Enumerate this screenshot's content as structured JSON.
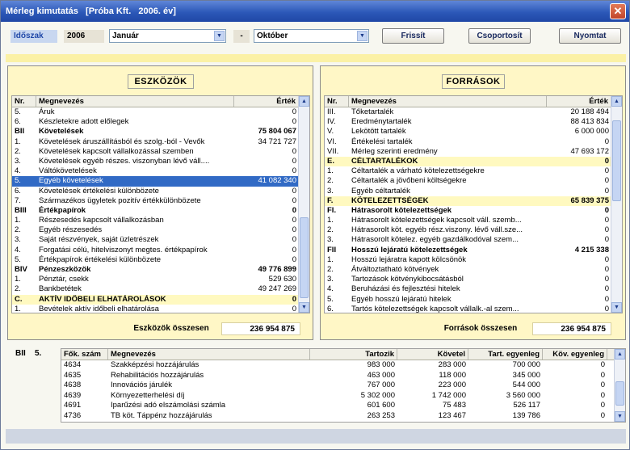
{
  "window": {
    "title": "Mérleg kimutatás   [Próba Kft.   2006. év]"
  },
  "toolbar": {
    "period_label": "Időszak",
    "year": "2006",
    "from_month": "Január",
    "dash": "-",
    "to_month": "Október",
    "refresh_label": "Frissít",
    "group_label": "Csoportosít",
    "print_label": "Nyomtat"
  },
  "assets": {
    "title": "ESZKÖZÖK",
    "col_nr": "Nr.",
    "col_name": "Megnevezés",
    "col_value": "Érték",
    "rows": [
      {
        "nr": "5.",
        "name": "Áruk",
        "value": "0"
      },
      {
        "nr": "6.",
        "name": "Készletekre adott előlegek",
        "value": "0"
      },
      {
        "nr": "BII",
        "name": "Követelések",
        "value": "75 804 067",
        "bold": true
      },
      {
        "nr": "1.",
        "name": "Követelések áruszállításból és szolg.-ból - Vevők",
        "value": "34 721 727"
      },
      {
        "nr": "2.",
        "name": "Követelések kapcsolt vállalkozással szemben",
        "value": "0"
      },
      {
        "nr": "3.",
        "name": "Követelések egyéb részes. viszonyban lévő váll....",
        "value": "0"
      },
      {
        "nr": "4.",
        "name": "Váltókövetelések",
        "value": "0"
      },
      {
        "nr": "5.",
        "name": "Egyéb követelések",
        "value": "41 082 340",
        "sel": true
      },
      {
        "nr": "6.",
        "name": "Követelések értékelési különbözete",
        "value": "0"
      },
      {
        "nr": "7.",
        "name": "Származékos ügyletek pozitív értékkülönbözete",
        "value": "0"
      },
      {
        "nr": "BIII",
        "name": "Értékpapírok",
        "value": "0",
        "bold": true
      },
      {
        "nr": "1.",
        "name": "Részesedés kapcsolt vállalkozásban",
        "value": "0"
      },
      {
        "nr": "2.",
        "name": "Egyéb részesedés",
        "value": "0"
      },
      {
        "nr": "3.",
        "name": "Saját részvények, saját üzletrészek",
        "value": "0"
      },
      {
        "nr": "4.",
        "name": "Forgatási célú, hitelviszonyt megtes. értékpapírok",
        "value": "0"
      },
      {
        "nr": "5.",
        "name": "Értékpapírok értékelési különbözete",
        "value": "0"
      },
      {
        "nr": "BIV",
        "name": "Pénzeszközök",
        "value": "49 776 899",
        "bold": true
      },
      {
        "nr": "1.",
        "name": "Pénztár, csekk",
        "value": "529 630"
      },
      {
        "nr": "2.",
        "name": "Bankbetétek",
        "value": "49 247 269"
      },
      {
        "nr": "C.",
        "name": "AKTÍV IDŐBELI ELHATÁROLÁSOK",
        "value": "0",
        "bold": true,
        "hl": true
      },
      {
        "nr": "1.",
        "name": "Bevételek aktív időbeli elhatárolása",
        "value": "0"
      }
    ],
    "total_label": "Eszközök összesen",
    "total_value": "236 954 875"
  },
  "liabilities": {
    "title": "FORRÁSOK",
    "col_nr": "Nr.",
    "col_name": "Megnevezés",
    "col_value": "Érték",
    "rows": [
      {
        "nr": "III.",
        "name": "Tőketartalék",
        "value": "20 188 494"
      },
      {
        "nr": "IV.",
        "name": "Eredménytartalék",
        "value": "88 413 834"
      },
      {
        "nr": "V.",
        "name": "Lekötött tartalék",
        "value": "6 000 000"
      },
      {
        "nr": "VI.",
        "name": "Értékelési tartalék",
        "value": "0"
      },
      {
        "nr": "VII.",
        "name": "Mérleg szerinti eredmény",
        "value": "47 693 172"
      },
      {
        "nr": "E.",
        "name": "CÉLTARTALÉKOK",
        "value": "0",
        "bold": true,
        "hl": true
      },
      {
        "nr": "1.",
        "name": "Céltartalék a várható kötelezettségekre",
        "value": "0"
      },
      {
        "nr": "2.",
        "name": "Céltartalék a jövőbeni költségekre",
        "value": "0"
      },
      {
        "nr": "3.",
        "name": "Egyéb céltartalék",
        "value": "0"
      },
      {
        "nr": "F.",
        "name": "KÖTELEZETTSÉGEK",
        "value": "65 839 375",
        "bold": true,
        "hl": true
      },
      {
        "nr": "FI.",
        "name": "Hátrasorolt kötelezettségek",
        "value": "0",
        "bold": true
      },
      {
        "nr": "1.",
        "name": "Hátrasorolt kötelezettségek kapcsolt váll. szemb...",
        "value": "0"
      },
      {
        "nr": "2.",
        "name": "Hátrasorolt köt. egyéb rész.viszony. lévő váll.sze...",
        "value": "0"
      },
      {
        "nr": "3.",
        "name": "Hátrasorolt kötelez. egyéb gazdálkodóval szem...",
        "value": "0"
      },
      {
        "nr": "FII",
        "name": "Hosszú lejáratú kötelezettségek",
        "value": "4 215 338",
        "bold": true
      },
      {
        "nr": "1.",
        "name": "Hosszú lejáratra kapott kölcsönök",
        "value": "0"
      },
      {
        "nr": "2.",
        "name": "Átváltoztatható kötvények",
        "value": "0"
      },
      {
        "nr": "3.",
        "name": "Tartozások kötvénykibocsátásból",
        "value": "0"
      },
      {
        "nr": "4.",
        "name": "Beruházási és fejlesztési hitelek",
        "value": "0"
      },
      {
        "nr": "5.",
        "name": "Egyéb hosszú lejáratú hitelek",
        "value": "0"
      },
      {
        "nr": "6.",
        "name": "Tartós kötelezettségek kapcsolt vállalk.-al szem...",
        "value": "0"
      }
    ],
    "total_label": "Források összesen",
    "total_value": "236 954 875"
  },
  "detail": {
    "section_code": "BII",
    "section_nr": "5.",
    "columns": [
      "Fők. szám",
      "Megnevezés",
      "Tartozik",
      "Követel",
      "Tart. egyenleg",
      "Köv. egyenleg"
    ],
    "rows": [
      [
        "4634",
        "Szakképzési hozzájárulás",
        "983 000",
        "283 000",
        "700 000",
        "0"
      ],
      [
        "4635",
        "Rehabilitációs hozzájárulás",
        "463 000",
        "118 000",
        "345 000",
        "0"
      ],
      [
        "4638",
        "Innovációs járulék",
        "767 000",
        "223 000",
        "544 000",
        "0"
      ],
      [
        "4639",
        "Környezetterhelési díj",
        "5 302 000",
        "1 742 000",
        "3 560 000",
        "0"
      ],
      [
        "4691",
        "Iparűzési adó elszámolási számla",
        "601 600",
        "75 483",
        "526 117",
        "0"
      ],
      [
        "4736",
        "TB köt. Táppénz hozzájárulás",
        "263 253",
        "123 467",
        "139 786",
        "0"
      ]
    ]
  }
}
